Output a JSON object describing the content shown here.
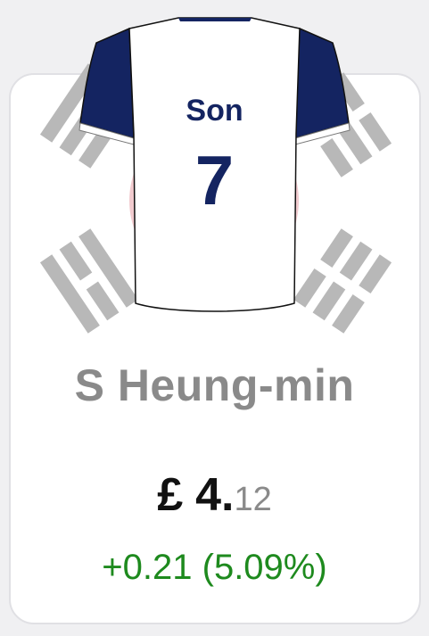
{
  "jersey": {
    "name": "Son",
    "number": "7",
    "body_color": "#ffffff",
    "sleeve_color": "#142461",
    "text_color": "#142461"
  },
  "player": {
    "display_name": "S Heung-min"
  },
  "price": {
    "currency": "£",
    "whole": "4.",
    "decimal": "12"
  },
  "change": {
    "text": "+0.21 (5.09%)",
    "color": "#1e8a1e"
  },
  "flag_icon": "south-korea-flag-icon"
}
